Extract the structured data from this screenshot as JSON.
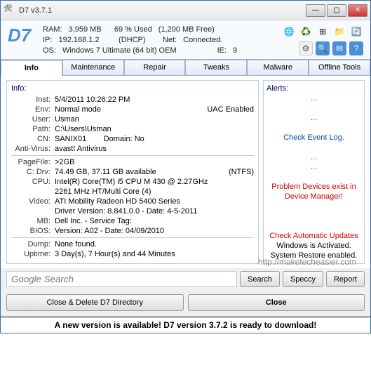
{
  "window": {
    "title": "D7  v3.7.1"
  },
  "header": {
    "logo": "D7",
    "ram_label": "RAM:",
    "ram_total": "3,959 MB",
    "ram_used": "69 % Used",
    "ram_free": "(1,200 MB Free)",
    "ip_label": "IP:",
    "ip": "192.168.1.2",
    "dhcp": "(DHCP)",
    "net_label": "Net:",
    "net": "Connected.",
    "os_label": "OS:",
    "os": "Windows 7 Ultimate  (64 bit) OEM",
    "ie_label": "IE:",
    "ie": "9"
  },
  "tabs": [
    "Info",
    "Maintenance",
    "Repair",
    "Tweaks",
    "Malware",
    "Offline Tools"
  ],
  "info": {
    "section_title": "Info:",
    "inst_k": "Inst:",
    "inst": "5/4/2011 10:26:22 PM",
    "env_k": "Env:",
    "env": "Normal mode",
    "uac": "UAC Enabled",
    "user_k": "User:",
    "user": "Usman",
    "path_k": "Path:",
    "path": "C:\\Users\\Usman",
    "cn_k": "CN:",
    "cn": "SANIX01",
    "domain_k": "Domain:",
    "domain": "No",
    "av_k": "Anti-Virus:",
    "av": "avast! Antivirus",
    "pagefile_k": "PageFile:",
    "pagefile": ">2GB",
    "cdrv_k": "C: Drv:",
    "cdrv": "74.49 GB, 37.11 GB available",
    "cdrv_fs": "(NTFS)",
    "cpu_k": "CPU:",
    "cpu": "Intel(R) Core(TM) i5 CPU       M 430  @ 2.27GHz",
    "cpu2": "2261 MHz HT/Multi Core (4)",
    "video_k": "Video:",
    "video": "ATI Mobility Radeon HD 5400 Series",
    "video2": "Driver Version:  8.841.0.0 - Date:  4-5-2011",
    "mb_k": "MB:",
    "mb": "Dell Inc. - Service Tag:",
    "bios_k": "BIOS:",
    "bios": "Version: A02 - Date:  04/09/2010",
    "dump_k": "Dump:",
    "dump": "None found.",
    "uptime_k": "Uptime:",
    "uptime": "3 Day(s), 7 Hour(s) and 44 Minutes"
  },
  "alerts": {
    "title": "Alerts:",
    "dots": "...",
    "check_log": "Check Event Log.",
    "prob_dev": "Problem Devices exist in Device Manager!",
    "auto_upd": "Check Automatic Updates",
    "activated": "Windows is Activated.",
    "restore": "System Restore enabled."
  },
  "watermark": "http://maketecheasier.com",
  "search": {
    "placeholder": "Google Search",
    "btn": "Search",
    "speccy": "Speccy",
    "report": "Report"
  },
  "bottom": {
    "delete": "Close & Delete D7 Directory",
    "close": "Close"
  },
  "update": "A new version is available!  D7 version 3.7.2 is ready to download!"
}
